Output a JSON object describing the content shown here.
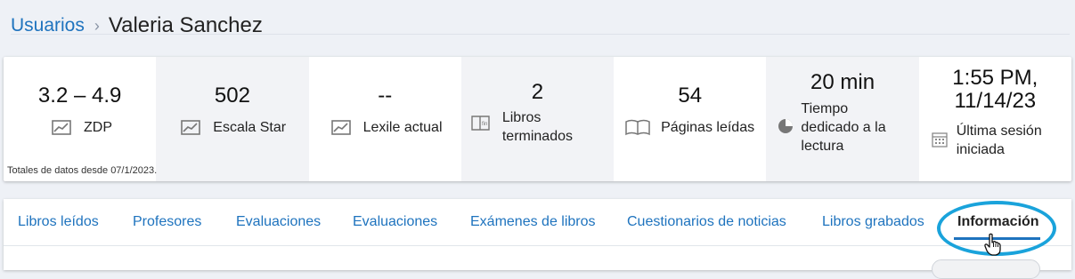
{
  "breadcrumb": {
    "parent": "Usuarios",
    "separator": "›",
    "current": "Valeria Sanchez"
  },
  "stats": [
    {
      "value": "3.2 – 4.9",
      "label": "ZDP",
      "icon": "trend-chart-icon"
    },
    {
      "value": "502",
      "label": "Escala Star",
      "icon": "trend-chart-icon"
    },
    {
      "value": "--",
      "label": "Lexile actual",
      "icon": "trend-chart-icon"
    },
    {
      "value": "2",
      "label": "Libros terminados",
      "icon": "book-fin-icon"
    },
    {
      "value": "54",
      "label": "Páginas leídas",
      "icon": "open-book-icon"
    },
    {
      "value": "20 min",
      "label": "Tiempo dedicado a la lectura",
      "icon": "pie-clock-icon"
    },
    {
      "value": "1:55 PM, 11/14/23",
      "label": "Última sesión iniciada",
      "icon": "calendar-icon"
    }
  ],
  "footnote": "Totales de datos desde 07/1/2023.",
  "tabs": [
    {
      "label": "Libros leídos"
    },
    {
      "label": "Profesores"
    },
    {
      "label": "Evaluaciones"
    },
    {
      "label": "Evaluaciones"
    },
    {
      "label": "Exámenes de libros"
    },
    {
      "label": "Cuestionarios de noticias"
    },
    {
      "label": "Libros grabados"
    },
    {
      "label": "Información",
      "active": true
    }
  ],
  "colors": {
    "link": "#1e73be",
    "highlight": "#1aa3db"
  }
}
